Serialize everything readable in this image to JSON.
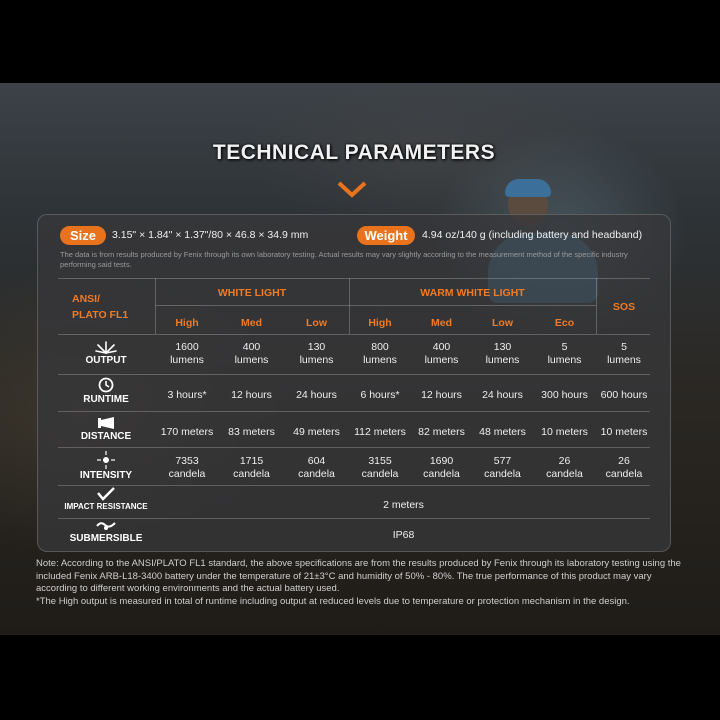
{
  "title": "TECHNICAL PARAMETERS",
  "size": {
    "label": "Size",
    "value": "3.15\" × 1.84\" × 1.37\"/80 × 46.8 × 34.9 mm"
  },
  "weight": {
    "label": "Weight",
    "value": "4.94 oz/140 g (including battery and headband)"
  },
  "disclaimer": "The data is from results produced by Fenix through its own laboratory testing. Actual results may vary slightly according to the measurement method of the specific industry performing said tests.",
  "table": {
    "corner": [
      "ANSI/",
      "PLATO FL1"
    ],
    "groups": {
      "white": "WHITE LIGHT",
      "warm": "WARM WHITE LIGHT",
      "sos": "SOS"
    },
    "modes": [
      "High",
      "Med",
      "Low",
      "High",
      "Med",
      "Low",
      "Eco"
    ],
    "rows": {
      "output": {
        "label": "OUTPUT",
        "cells": [
          [
            "1600",
            "lumens"
          ],
          [
            "400",
            "lumens"
          ],
          [
            "130",
            "lumens"
          ],
          [
            "800",
            "lumens"
          ],
          [
            "400",
            "lumens"
          ],
          [
            "130",
            "lumens"
          ],
          [
            "5",
            "lumens"
          ],
          [
            "5",
            "lumens"
          ]
        ]
      },
      "runtime": {
        "label": "RUNTIME",
        "cells": [
          "3 hours*",
          "12 hours",
          "24 hours",
          "6 hours*",
          "12 hours",
          "24 hours",
          "300 hours",
          "600 hours"
        ]
      },
      "distance": {
        "label": "DISTANCE",
        "cells": [
          "170 meters",
          "83 meters",
          "49 meters",
          "112 meters",
          "82 meters",
          "48 meters",
          "10 meters",
          "10 meters"
        ]
      },
      "intensity": {
        "label": "INTENSITY",
        "cells": [
          [
            "7353",
            "candela"
          ],
          [
            "1715",
            "candela"
          ],
          [
            "604",
            "candela"
          ],
          [
            "3155",
            "candela"
          ],
          [
            "1690",
            "candela"
          ],
          [
            "577",
            "candela"
          ],
          [
            "26",
            "candela"
          ],
          [
            "26",
            "candela"
          ]
        ]
      },
      "impact": {
        "label": "IMPACT RESISTANCE",
        "value": "2 meters"
      },
      "submersible": {
        "label": "SUBMERSIBLE",
        "value": "IP68"
      }
    }
  },
  "note": {
    "line1": "Note: According to the ANSI/PLATO FL1 standard, the above specifications are from the results produced by Fenix through its laboratory testing using the included Fenix ARB-L18-3400 battery under the temperature of 21±3°C and humidity of 50% - 80%. The true performance of this product may vary according to different working environments and the actual battery used.",
    "line2": "*The High output is measured in total of runtime including output at reduced levels due to temperature or protection mechanism in the design."
  },
  "colors": {
    "accent": "#e9731c",
    "header_text": "#ef7b25"
  }
}
